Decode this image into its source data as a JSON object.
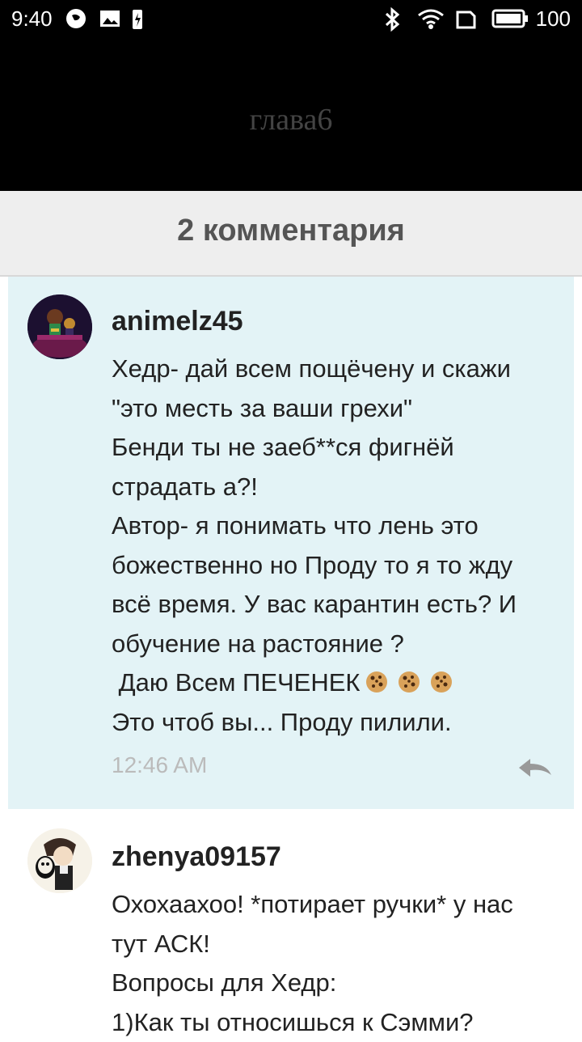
{
  "status_bar": {
    "time": "9:40",
    "battery": "100"
  },
  "header": {
    "title": "глава6"
  },
  "comments_header": {
    "count_label": "2 комментария"
  },
  "comments": [
    {
      "username": "animelz45",
      "lines": [
        "Хедр- дай всем пощёчену и скажи",
        "\"это месть за ваши грехи\"",
        "Бенди ты не заеб**ся фигнёй",
        "страдать а?!",
        "Автор- я понимать что лень это",
        "божественно но Проду то я то жду",
        "всё время. У вас карантин есть? И",
        "обучение на растояние ?",
        " Даю Всем ПЕЧЕНЕК",
        "Это чтоб вы... Проду пилили."
      ],
      "time": "12:46 AM"
    },
    {
      "username": "zhenya09157",
      "lines": [
        "Охохаахоо! *потирает ручки* у нас",
        "тут АСК!",
        "Вопросы для Хедр:",
        "1)Как ты относишься к Сэмми?"
      ]
    }
  ],
  "colors": {
    "highlight_comment_bg": "#e3f3f6",
    "header_bg": "#000000",
    "comments_bar_bg": "#eeeeee"
  }
}
